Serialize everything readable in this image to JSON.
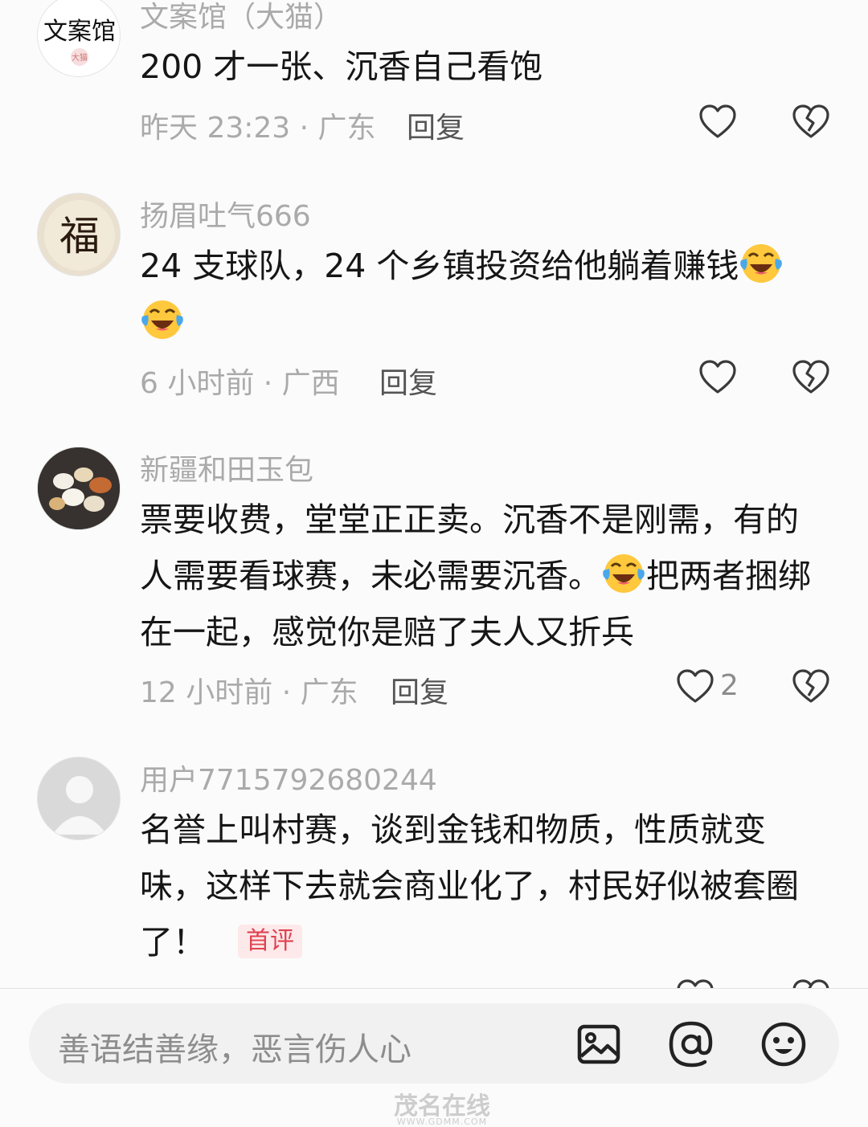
{
  "comments": [
    {
      "username": "文案馆（大猫）",
      "avatar_text": "文案馆",
      "avatar_small_text": "大猫",
      "text": "200 才一张、沉香自己看饱",
      "meta": "昨天 23:23 · 广东",
      "reply_label": "回复"
    },
    {
      "username": "扬眉吐气666",
      "avatar_text": "福",
      "text": "24 支球队，24 个乡镇投资给他躺着赚钱",
      "meta": "6 小时前 · 广西",
      "reply_label": "回复"
    },
    {
      "username": "新疆和田玉包",
      "text_part1": "票要收费，堂堂正正卖。沉香不是刚需，有的人需要看球赛，未必需要沉香。",
      "text_part2": "把两者捆绑在一起，感觉你是赔了夫人又折兵",
      "meta": "12 小时前 · 广东",
      "reply_label": "回复",
      "like_count": "2"
    },
    {
      "username": "用户7715792680244",
      "text": "名誉上叫村赛，谈到金钱和物质，性质就变味，这样下去就会商业化了，村民好似被套圈了！",
      "badge": "首评"
    }
  ],
  "input": {
    "placeholder": "善语结善缘，恶言伤人心"
  },
  "icons": {
    "like": "heart-outline-icon",
    "dislike": "broken-heart-icon",
    "emoji": "laughing-tears-emoji",
    "image": "image-icon",
    "mention": "at-icon",
    "face": "smiley-icon"
  },
  "watermark": {
    "text": "茂名在线",
    "sub": "WWW.GDMM.COM"
  }
}
